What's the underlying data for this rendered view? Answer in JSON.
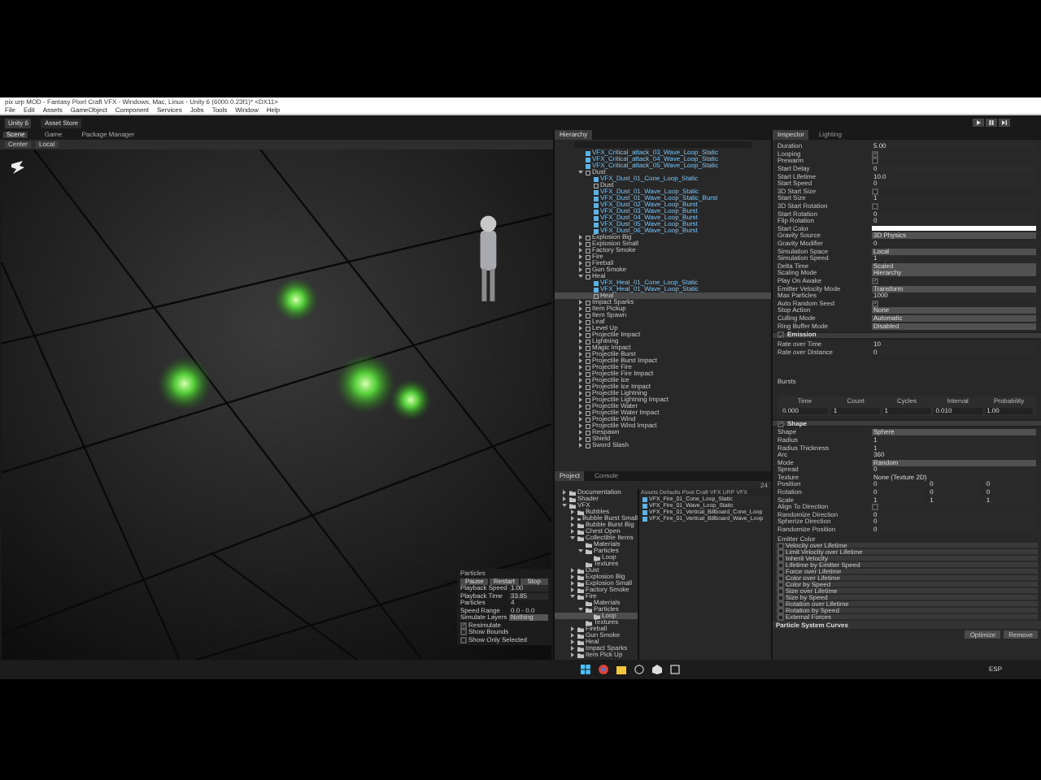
{
  "window": {
    "title": "pix urp MOD - Fantasy Pixel Craft VFX - Windows, Mac, Linux - Unity 6 (6000.0.23f1)* <DX11>"
  },
  "menu": [
    "File",
    "Edit",
    "Assets",
    "GameObject",
    "Component",
    "Services",
    "Jobs",
    "Tools",
    "Window",
    "Help"
  ],
  "toolbar": {
    "account": "Unity 6",
    "store": "Asset Store"
  },
  "scene_tabs": [
    {
      "label": "Scene",
      "selected": true
    },
    {
      "label": "Game",
      "selected": false
    },
    {
      "label": "Package Manager",
      "selected": false
    }
  ],
  "scene_toolbar": [
    "Center",
    "Local"
  ],
  "particles_overlay": {
    "title": "Particles",
    "buttons": [
      "Pause",
      "Restart",
      "Stop"
    ],
    "rows": [
      {
        "kind": "field",
        "label": "Playback Speed",
        "value": "1.00"
      },
      {
        "kind": "field",
        "label": "Playback Time",
        "value": "33.85"
      },
      {
        "kind": "text",
        "label": "Particles",
        "value": "4"
      },
      {
        "kind": "text",
        "label": "Speed Range",
        "value": "0.0 - 0.0"
      },
      {
        "kind": "select",
        "label": "Simulate Layers",
        "value": "Nothing"
      },
      {
        "kind": "check",
        "label": "Resimulate",
        "checked": true
      },
      {
        "kind": "check",
        "label": "Show Bounds",
        "checked": false
      },
      {
        "kind": "check",
        "label": "Show Only Selected",
        "checked": false
      }
    ]
  },
  "hierarchy": {
    "tab": "Hierarchy",
    "items": [
      {
        "label": "VFX_Critical_attack_03_Wave_Loop_Static",
        "prefab": true,
        "selected": false
      },
      {
        "label": "VFX_Critical_attack_04_Wave_Loop_Static",
        "prefab": true,
        "selected": false
      },
      {
        "label": "VFX_Critical_attack_05_Wave_Loop_Static",
        "prefab": true,
        "selected": false
      },
      {
        "label": "Dust",
        "prefab": false,
        "selected": false,
        "expanded": true,
        "children": [
          {
            "label": "VFX_Dust_01_Cone_Loop_Static",
            "prefab": true,
            "selected": false
          },
          {
            "label": "Dust",
            "prefab": false,
            "selected": false
          },
          {
            "label": "VFX_Dust_01_Wave_Loop_Static",
            "prefab": true,
            "selected": false
          },
          {
            "label": "VFX_Dust_01_Wave_Loop_Static_Burst",
            "prefab": true,
            "selected": false
          },
          {
            "label": "VFX_Dust_02_Wave_Loop_Burst",
            "prefab": true,
            "selected": false
          },
          {
            "label": "VFX_Dust_03_Wave_Loop_Burst",
            "prefab": true,
            "selected": false
          },
          {
            "label": "VFX_Dust_04_Wave_Loop_Burst",
            "prefab": true,
            "selected": false
          },
          {
            "label": "VFX_Dust_05_Wave_Loop_Burst",
            "prefab": true,
            "selected": false
          },
          {
            "label": "VFX_Dust_06_Wave_Loop_Burst",
            "prefab": true,
            "selected": false
          }
        ]
      },
      {
        "label": "Explosion Big",
        "prefab": false,
        "selected": false,
        "expanded": false
      },
      {
        "label": "Explosion Small",
        "prefab": false,
        "selected": false,
        "expanded": false
      },
      {
        "label": "Factory Smoke",
        "prefab": false,
        "selected": false,
        "expanded": false
      },
      {
        "label": "Fire",
        "prefab": false,
        "selected": false,
        "expanded": false
      },
      {
        "label": "Fireball",
        "prefab": false,
        "selected": false,
        "expanded": false
      },
      {
        "label": "Gun Smoke",
        "prefab": false,
        "selected": false,
        "expanded": false
      },
      {
        "label": "Heal",
        "prefab": false,
        "selected": false,
        "expanded": true,
        "children": [
          {
            "label": "VFX_Heal_01_Cone_Loop_Static",
            "prefab": true,
            "selected": false
          },
          {
            "label": "VFX_Heal_01_Wave_Loop_Static",
            "prefab": true,
            "selected": false
          },
          {
            "label": "Heal",
            "prefab": false,
            "selected": true
          }
        ]
      },
      {
        "label": "Impact Sparks",
        "prefab": false,
        "selected": false,
        "expanded": false
      },
      {
        "label": "Item Pickup",
        "prefab": false,
        "selected": false,
        "expanded": false
      },
      {
        "label": "Item Spawn",
        "prefab": false,
        "selected": false,
        "expanded": false
      },
      {
        "label": "Leaf",
        "prefab": false,
        "selected": false,
        "expanded": false
      },
      {
        "label": "Level Up",
        "prefab": false,
        "selected": false,
        "expanded": false
      },
      {
        "label": "Projectile Impact",
        "prefab": false,
        "selected": false,
        "expanded": false
      },
      {
        "label": "Lightning",
        "prefab": false,
        "selected": false,
        "expanded": false
      },
      {
        "label": "Magic Impact",
        "prefab": false,
        "selected": false,
        "expanded": false
      },
      {
        "label": "Projectile Burst",
        "prefab": false,
        "selected": false,
        "expanded": false
      },
      {
        "label": "Projectile Burst Impact",
        "prefab": false,
        "selected": false,
        "expanded": false
      },
      {
        "label": "Projectile Fire",
        "prefab": false,
        "selected": false,
        "expanded": false
      },
      {
        "label": "Projectile Fire Impact",
        "prefab": false,
        "selected": false,
        "expanded": false
      },
      {
        "label": "Projectile Ice",
        "prefab": false,
        "selected": false,
        "expanded": false
      },
      {
        "label": "Projectile Ice Impact",
        "prefab": false,
        "selected": false,
        "expanded": false
      },
      {
        "label": "Projectile Lightning",
        "prefab": false,
        "selected": false,
        "expanded": false
      },
      {
        "label": "Projectile Lightning Impact",
        "prefab": false,
        "selected": false,
        "expanded": false
      },
      {
        "label": "Projectile Water",
        "prefab": false,
        "selected": false,
        "expanded": false
      },
      {
        "label": "Projectile Water Impact",
        "prefab": false,
        "selected": false,
        "expanded": false
      },
      {
        "label": "Projectile Wind",
        "prefab": false,
        "selected": false,
        "expanded": false
      },
      {
        "label": "Projectile Wind Impact",
        "prefab": false,
        "selected": false,
        "expanded": false
      },
      {
        "label": "Respawn",
        "prefab": false,
        "selected": false,
        "expanded": false
      },
      {
        "label": "Shield",
        "prefab": false,
        "selected": false,
        "expanded": false
      },
      {
        "label": "Sword Slash",
        "prefab": false,
        "selected": false,
        "expanded": false
      }
    ]
  },
  "project": {
    "tabs": [
      {
        "label": "Project",
        "selected": true
      },
      {
        "label": "Console",
        "selected": false
      }
    ],
    "count": "24",
    "folders": [
      {
        "label": "Documentation",
        "selected": false,
        "expanded": false
      },
      {
        "label": "Shader",
        "selected": false,
        "expanded": false
      },
      {
        "label": "VFX",
        "selected": false,
        "expanded": true,
        "children": [
          {
            "label": "Bubbles",
            "selected": false,
            "expanded": false
          },
          {
            "label": "Bubble Burst Small",
            "selected": false,
            "expanded": false
          },
          {
            "label": "Bubble Burst Big",
            "selected": false,
            "expanded": false
          },
          {
            "label": "Chest Open",
            "selected": false,
            "expanded": false
          },
          {
            "label": "Collectible Items",
            "selected": false,
            "expanded": true,
            "children": [
              {
                "label": "Materials",
                "selected": false
              },
              {
                "label": "Particles",
                "selected": false,
                "expanded": true,
                "children": [
                  {
                    "label": "Loop",
                    "selected": false
                  }
                ]
              },
              {
                "label": "Textures",
                "selected": false
              }
            ]
          },
          {
            "label": "Dust",
            "selected": false,
            "expanded": false
          },
          {
            "label": "Explosion Big",
            "selected": false,
            "expanded": false
          },
          {
            "label": "Explosion Small",
            "selected": false,
            "expanded": false
          },
          {
            "label": "Factory Smoke",
            "selected": false,
            "expanded": false
          },
          {
            "label": "Fire",
            "selected": false,
            "expanded": true,
            "children": [
              {
                "label": "Materials",
                "selected": false
              },
              {
                "label": "Particles",
                "selected": false,
                "expanded": true,
                "children": [
                  {
                    "label": "Loop",
                    "selected": true
                  }
                ]
              },
              {
                "label": "Textures",
                "selected": false
              }
            ]
          },
          {
            "label": "Fireball",
            "selected": false,
            "expanded": false
          },
          {
            "label": "Gun Smoke",
            "selected": false,
            "expanded": false
          },
          {
            "label": "Heal",
            "selected": false,
            "expanded": false
          },
          {
            "label": "Impact Sparks",
            "selected": false,
            "expanded": false
          },
          {
            "label": "Item Pick Up",
            "selected": false,
            "expanded": false
          }
        ]
      }
    ],
    "breadcrumb": [
      "Assets",
      "Defaults",
      "Pixel Craft VFX URP",
      "VFX"
    ],
    "assets": [
      "VFX_Fire_01_Cone_Loop_Static",
      "VFX_Fire_01_Wave_Loop_Static",
      "VFX_Fire_01_Vertical_Billboard_Cone_Loop",
      "VFX_Fire_01_Vertical_Billboard_Wave_Loop"
    ]
  },
  "inspector": {
    "tabs": [
      {
        "label": "Inspector",
        "selected": true
      },
      {
        "label": "Lighting",
        "selected": false
      }
    ],
    "rows": [
      {
        "kind": "field",
        "label": "Duration",
        "value": "5.00"
      },
      {
        "kind": "check",
        "label": "Looping",
        "checked": true
      },
      {
        "kind": "check",
        "label": "Prewarm",
        "checked": false
      },
      {
        "kind": "field",
        "label": "Start Delay",
        "value": "0"
      },
      {
        "kind": "field",
        "label": "Start Lifetime",
        "value": "10.0"
      },
      {
        "kind": "field",
        "label": "Start Speed",
        "value": "0"
      },
      {
        "kind": "check",
        "label": "3D Start Size",
        "checked": false
      },
      {
        "kind": "field",
        "label": "Start Size",
        "value": "1"
      },
      {
        "kind": "check",
        "label": "3D Start Rotation",
        "checked": false
      },
      {
        "kind": "field",
        "label": "Start Rotation",
        "value": "0"
      },
      {
        "kind": "field",
        "label": "Flip Rotation",
        "value": "0"
      },
      {
        "kind": "color",
        "label": "Start Color",
        "color": "#ffffff"
      },
      {
        "kind": "select",
        "label": "Gravity Source",
        "value": "3D Physics"
      },
      {
        "kind": "field",
        "label": "Gravity Modifier",
        "value": "0"
      },
      {
        "kind": "select",
        "label": "Simulation Space",
        "value": "Local"
      },
      {
        "kind": "field",
        "label": "Simulation Speed",
        "value": "1"
      },
      {
        "kind": "select",
        "label": "Delta Time",
        "value": "Scaled"
      },
      {
        "kind": "select",
        "label": "Scaling Mode",
        "value": "Hierarchy"
      },
      {
        "kind": "check",
        "label": "Play On Awake",
        "checked": true
      },
      {
        "kind": "select",
        "label": "Emitter Velocity Mode",
        "value": "Transform"
      },
      {
        "kind": "field",
        "label": "Max Particles",
        "value": "1000"
      },
      {
        "kind": "check",
        "label": "Auto Random Seed",
        "checked": true
      },
      {
        "kind": "select",
        "label": "Stop Action",
        "value": "None"
      },
      {
        "kind": "select",
        "label": "Culling Mode",
        "value": "Automatic"
      },
      {
        "kind": "select",
        "label": "Ring Buffer Mode",
        "value": "Disabled"
      },
      {
        "kind": "section",
        "label": "Emission",
        "checked": true
      },
      {
        "kind": "field",
        "label": "Rate over Time",
        "value": "10"
      },
      {
        "kind": "field",
        "label": "Rate over Distance",
        "value": "0"
      },
      {
        "kind": "bursts",
        "label": "Bursts",
        "columns": [
          "Time",
          "Count",
          "Cycles",
          "Interval",
          "Probability"
        ],
        "values": [
          "0.000",
          "1",
          "1",
          "0.010",
          "1.00"
        ]
      },
      {
        "kind": "section",
        "label": "Shape",
        "checked": true
      },
      {
        "kind": "select",
        "label": "Shape",
        "value": "Sphere"
      },
      {
        "kind": "field",
        "label": "Radius",
        "value": "1"
      },
      {
        "kind": "field",
        "label": "Radius Thickness",
        "value": "1"
      },
      {
        "kind": "field",
        "label": "Arc",
        "value": "360"
      },
      {
        "kind": "select",
        "label": "Mode",
        "value": "Random"
      },
      {
        "kind": "field",
        "label": "Spread",
        "value": "0"
      },
      {
        "kind": "field",
        "label": "Texture",
        "value": "None (Texture 2D)"
      },
      {
        "kind": "vector",
        "label": "Position",
        "values": [
          "0",
          "0",
          "0"
        ]
      },
      {
        "kind": "vector",
        "label": "Rotation",
        "values": [
          "0",
          "0",
          "0"
        ]
      },
      {
        "kind": "vector",
        "label": "Scale",
        "values": [
          "1",
          "1",
          "1"
        ]
      },
      {
        "kind": "check",
        "label": "Align To Direction",
        "checked": false
      },
      {
        "kind": "field",
        "label": "Randomize Direction",
        "value": "0"
      },
      {
        "kind": "field",
        "label": "Spherize Direction",
        "value": "0"
      },
      {
        "kind": "field",
        "label": "Randomize Position",
        "value": "0"
      }
    ],
    "emitter_label": "Emitter Color",
    "modules": [
      {
        "label": "Velocity over Lifetime",
        "checked": false
      },
      {
        "label": "Limit Velocity over Lifetime",
        "checked": false
      },
      {
        "label": "Inherit Velocity",
        "checked": false
      },
      {
        "label": "Lifetime by Emitter Speed",
        "checked": false
      },
      {
        "label": "Force over Lifetime",
        "checked": false
      },
      {
        "label": "Color over Lifetime",
        "checked": false
      },
      {
        "label": "Color by Speed",
        "checked": false
      },
      {
        "label": "Size over Lifetime",
        "checked": false
      },
      {
        "label": "Size by Speed",
        "checked": false
      },
      {
        "label": "Rotation over Lifetime",
        "checked": false
      },
      {
        "label": "Rotation by Speed",
        "checked": false
      },
      {
        "label": "External Forces",
        "checked": false
      }
    ],
    "curves_title": "Particle System Curves",
    "curve_buttons": [
      "Optimize",
      "Remove"
    ]
  },
  "taskbar": {
    "language": "ESP"
  }
}
